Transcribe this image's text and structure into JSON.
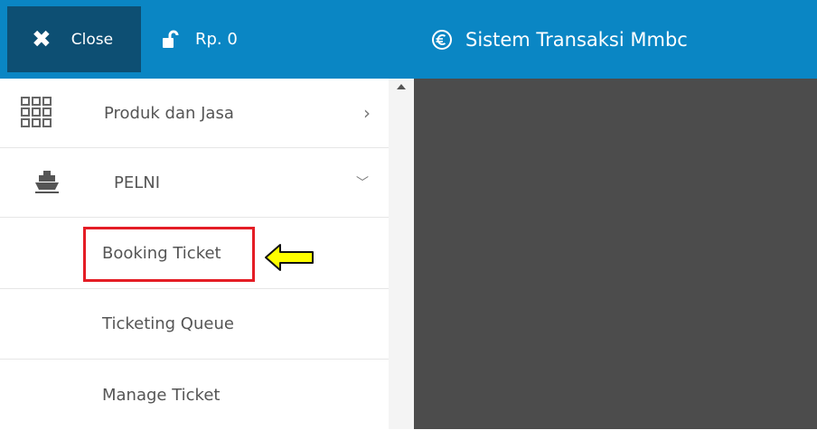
{
  "header": {
    "close_label": "Close",
    "balance_label": "Rp. 0",
    "app_title": "Sistem Transaksi Mmbc"
  },
  "sidebar": {
    "items": [
      {
        "label": "Produk dan Jasa",
        "icon": "grid-icon",
        "chevron": "chevron-right-icon"
      },
      {
        "label": "PELNI",
        "icon": "ship-icon",
        "chevron": "chevron-down-icon"
      }
    ],
    "subitems": [
      {
        "label": "Booking Ticket"
      },
      {
        "label": "Ticketing Queue"
      },
      {
        "label": "Manage Ticket"
      }
    ]
  },
  "colors": {
    "topbar": "#0a86c4",
    "close_bg": "#0d4f73",
    "main_bg": "#4c4c4c",
    "highlight": "#e41d25",
    "arrow": "#ffff00"
  }
}
